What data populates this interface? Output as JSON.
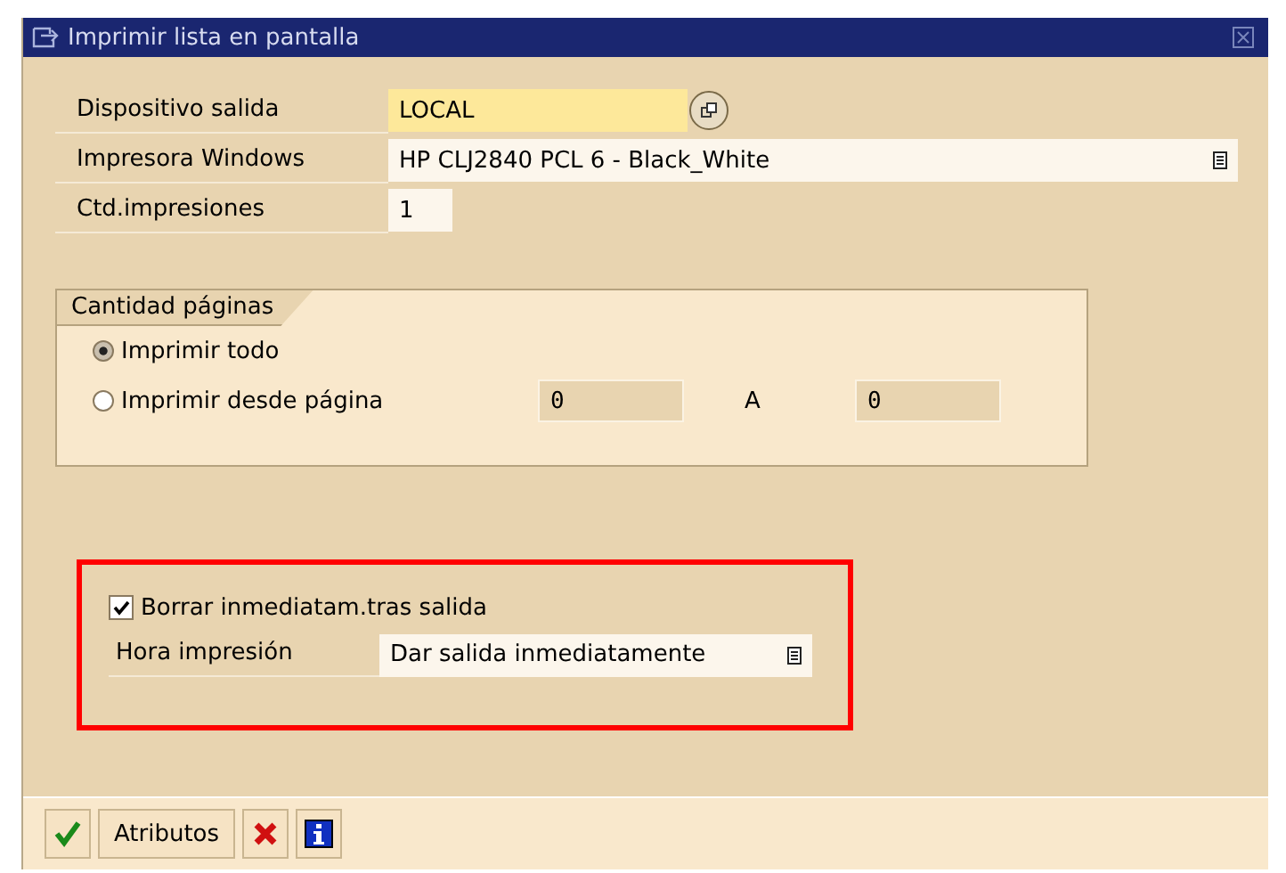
{
  "window": {
    "title": "Imprimir lista en pantalla"
  },
  "fields": [
    {
      "label": "Dispositivo salida",
      "value": "LOCAL",
      "kind": "required"
    },
    {
      "label": "Impresora Windows",
      "value": "HP CLJ2840 PCL 6 - Black_White",
      "kind": "dropdown"
    },
    {
      "label": "Ctd.impresiones",
      "value": "1",
      "kind": "plain"
    }
  ],
  "page_group": {
    "title": "Cantidad páginas",
    "options": [
      {
        "label": "Imprimir todo",
        "selected": true
      },
      {
        "label": "Imprimir desde página",
        "selected": false
      }
    ],
    "from_value": "0",
    "to_label": "A",
    "to_value": "0"
  },
  "output_options": {
    "checkbox": {
      "label": "Borrar inmediatam.tras salida",
      "checked": true
    },
    "time_field": {
      "label": "Hora impresión",
      "value": "Dar salida inmediatamente"
    }
  },
  "toolbar": [
    {
      "kind": "confirm"
    },
    {
      "kind": "text",
      "label": "Atributos"
    },
    {
      "kind": "cancel"
    },
    {
      "kind": "info"
    }
  ]
}
